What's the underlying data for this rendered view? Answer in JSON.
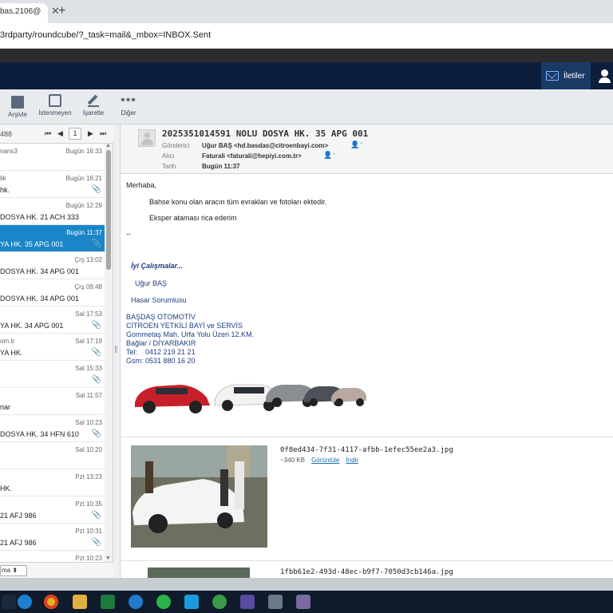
{
  "browser": {
    "tab_title": "bas.2106@",
    "tab_close": "✕",
    "new_tab": "+",
    "url": "3rdparty/roundcube/?_task=mail&_mbox=INBOX.Sent"
  },
  "app_header": {
    "mail_nav_label": "İletiler"
  },
  "toolbar": {
    "archive_label": "Arşivle",
    "junk_label": "İstenmeyen",
    "mark_label": "İşaretle",
    "more_label": "Diğer"
  },
  "list": {
    "count": "488",
    "page": "1",
    "pager": {
      "first": "⏮",
      "prev": "◀",
      "next": "▶",
      "last": "⏭"
    },
    "rows": [
      {
        "from": "nans3",
        "date": "Bugün 16:33",
        "subject": "",
        "attachment": false,
        "selected": false
      },
      {
        "from": "lik",
        "date": "Bugün 16:21",
        "subject": "hk.",
        "attachment": true,
        "selected": false
      },
      {
        "from": "",
        "date": "Bugün 12:29",
        "subject": "DOSYA HK. 21 ACH 333",
        "attachment": false,
        "selected": false
      },
      {
        "from": "",
        "date": "Bugün 11:37",
        "subject": "YA HK. 35 APG 001",
        "attachment": true,
        "selected": true
      },
      {
        "from": "",
        "date": "Çrş 13:02",
        "subject": "DOSYA HK. 34 APG 001",
        "attachment": false,
        "selected": false
      },
      {
        "from": "",
        "date": "Çrş 09:48",
        "subject": "DOSYA HK. 34 APG 001",
        "attachment": false,
        "selected": false
      },
      {
        "from": "",
        "date": "Sal 17:53",
        "subject": "YA HK. 34 APG 001",
        "attachment": true,
        "selected": false
      },
      {
        "from": "om.tr",
        "date": "Sal 17:19",
        "subject": "YA HK.",
        "attachment": true,
        "selected": false
      },
      {
        "from": "",
        "date": "Sal 15:33",
        "subject": "",
        "attachment": true,
        "selected": false
      },
      {
        "from": "",
        "date": "Sal 11:57",
        "subject": "nar",
        "attachment": false,
        "selected": false
      },
      {
        "from": "",
        "date": "Sal 10:23",
        "subject": "DOSYA HK. 34 HFN 610",
        "attachment": true,
        "selected": false
      },
      {
        "from": "",
        "date": "Sal 10:20",
        "subject": "",
        "attachment": false,
        "selected": false
      },
      {
        "from": "",
        "date": "Pzt 13:23",
        "subject": "HK.",
        "attachment": false,
        "selected": false
      },
      {
        "from": "",
        "date": "Pzt 10:35",
        "subject": "21 AFJ 986",
        "attachment": true,
        "selected": false
      },
      {
        "from": "",
        "date": "Pzt 10:31",
        "subject": "21 AFJ 986",
        "attachment": true,
        "selected": false
      },
      {
        "from": "",
        "date": "Pzt 10:23",
        "subject": "",
        "attachment": false,
        "selected": false
      }
    ],
    "footer_select": "ma"
  },
  "message": {
    "subject": "2025351014591 NOLU DOSYA HK. 35 APG 001",
    "from_label": "Gönderici",
    "from_value": "Uğur BAŞ <hd.basdas@citroenbayi.com>",
    "to_label": "Alıcı",
    "to_value": "Faturali <faturali@hepiyi.com.tr>",
    "date_label": "Tarih",
    "date_value": "Bugün 11:37",
    "greeting": "Merhaba,",
    "line1": "Bahse konu olan aracın tüm evraklan ve fotoları ektedir.",
    "line2": "Eksper ataması rica ederim",
    "sep": "--",
    "sig_wishes": "İyi Çalışmalar...",
    "sig_name": "Uğur BAŞ",
    "sig_title": "Hasar Sorumlusu",
    "sig_company": "BAŞDAŞ OTOMOTİV",
    "sig_dealer": "CİTROEN YETKİLİ BAYİ ve SERVİS",
    "sig_addr1": "Gommetaş Mah. Urfa Yolu Üzeri 12.KM.",
    "sig_addr2": "Bağlar / DİYARBAKIR",
    "sig_tel": "Tel:    0412 219 21 21",
    "sig_gsm": "Gsm: 0531 880 16 20",
    "attachments": [
      {
        "name": "0f8ed434-7f31-4117-afbb-1efec55ee2a3.jpg",
        "size": "~340 KB",
        "view": "Görüntüle",
        "download": "İndir"
      },
      {
        "name": "1fbb61e2-493d-48ec-b9f7-7050d3cb146a.jpg"
      }
    ]
  },
  "colors": {
    "header_bg": "#0c1e3c",
    "selected_row": "#1a86c8",
    "signature_blue": "#1f3c84"
  }
}
